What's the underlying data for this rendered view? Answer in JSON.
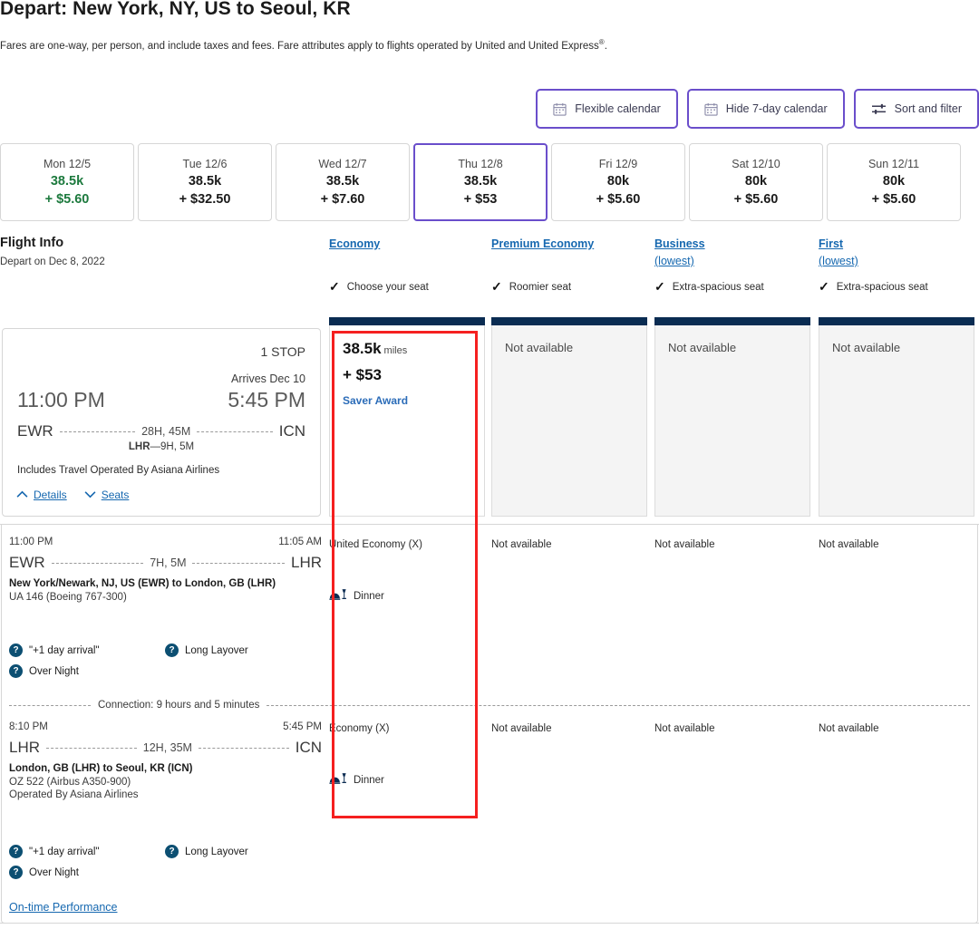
{
  "header": {
    "title": "Depart: New York, NY, US to Seoul, KR",
    "note_line1": "Fares are one-way, per person, and include taxes and fees. Fare attributes apply to flights operated by United and United",
    "note_line2": "Express",
    "note_sup": "®",
    "note_period": "."
  },
  "toolbar": {
    "flexible_calendar": "Flexible calendar",
    "hide_7day_calendar": "Hide 7-day calendar",
    "sort_and_filter": "Sort and filter",
    "accent_purple": "#6a4ecb"
  },
  "date_strip": {
    "cards": [
      {
        "dow": "Mon 12/5",
        "miles": "38.5k",
        "cash": "+ $5.60",
        "selected": false,
        "lowest": true
      },
      {
        "dow": "Tue 12/6",
        "miles": "38.5k",
        "cash": "+ $32.50",
        "selected": false,
        "lowest": false
      },
      {
        "dow": "Wed 12/7",
        "miles": "38.5k",
        "cash": "+ $7.60",
        "selected": false,
        "lowest": false
      },
      {
        "dow": "Thu 12/8",
        "miles": "38.5k",
        "cash": "+ $53",
        "selected": true,
        "lowest": false
      },
      {
        "dow": "Fri 12/9",
        "miles": "80k",
        "cash": "+ $5.60",
        "selected": false,
        "lowest": false
      },
      {
        "dow": "Sat 12/10",
        "miles": "80k",
        "cash": "+ $5.60",
        "selected": false,
        "lowest": false
      },
      {
        "dow": "Sun 12/11",
        "miles": "80k",
        "cash": "+ $5.60",
        "selected": false,
        "lowest": false
      }
    ],
    "lowest_color": "#1d7a3e"
  },
  "flight_info": {
    "label": "Flight Info",
    "depart_on": "Depart on Dec 8, 2022"
  },
  "cabins": [
    {
      "name": "Economy",
      "lowest": "",
      "perk": "Choose your seat"
    },
    {
      "name": "Premium Economy",
      "lowest": "",
      "perk": "Roomier seat"
    },
    {
      "name": "Business",
      "lowest": "(lowest)",
      "perk": "Extra-spacious seat"
    },
    {
      "name": "First",
      "lowest": "(lowest)",
      "perk": "Extra-spacious seat"
    }
  ],
  "summary": {
    "stops": "1 STOP",
    "arrives": "Arrives Dec 10",
    "depart_time": "11:00 PM",
    "arrive_time": "5:45 PM",
    "origin": "EWR",
    "destination": "ICN",
    "duration": "28H, 45M",
    "layover_code": "LHR",
    "layover_sep": "—",
    "layover_dur": "9H, 5M",
    "operated_note": "Includes Travel Operated By Asiana Airlines",
    "details_link": "Details",
    "seats_link": "Seats"
  },
  "summary_fares": [
    {
      "available": true,
      "miles": "38.5k",
      "miles_unit": "miles",
      "cash": "+ $53",
      "award": "Saver Award",
      "na_text": ""
    },
    {
      "available": false,
      "miles": "",
      "miles_unit": "",
      "cash": "",
      "award": "",
      "na_text": "Not available"
    },
    {
      "available": false,
      "miles": "",
      "miles_unit": "",
      "cash": "",
      "award": "",
      "na_text": "Not available"
    },
    {
      "available": false,
      "miles": "",
      "miles_unit": "",
      "cash": "",
      "award": "",
      "na_text": "Not available"
    }
  ],
  "segments": [
    {
      "depart_time": "11:00 PM",
      "arrive_time": "11:05 AM",
      "origin": "EWR",
      "destination": "LHR",
      "duration": "7H, 5M",
      "city_pair": "New York/Newark, NJ, US (EWR) to London, GB (LHR)",
      "flight": "UA 146 (Boeing 767-300)",
      "operated_by": "",
      "badges": [
        "\"+1 day arrival\"",
        "Long Layover",
        "Over Night"
      ],
      "fares": [
        {
          "cabin": "United Economy (X)",
          "meal": "Dinner"
        },
        {
          "cabin": "Not available",
          "meal": ""
        },
        {
          "cabin": "Not available",
          "meal": ""
        },
        {
          "cabin": "Not available",
          "meal": ""
        }
      ]
    },
    {
      "depart_time": "8:10 PM",
      "arrive_time": "5:45 PM",
      "origin": "LHR",
      "destination": "ICN",
      "duration": "12H, 35M",
      "city_pair": "London, GB (LHR) to Seoul, KR (ICN)",
      "flight": "OZ 522 (Airbus A350-900)",
      "operated_by": "Operated By Asiana Airlines",
      "badges": [
        "\"+1 day arrival\"",
        "Long Layover",
        "Over Night"
      ],
      "fares": [
        {
          "cabin": "Economy (X)",
          "meal": "Dinner"
        },
        {
          "cabin": "Not available",
          "meal": ""
        },
        {
          "cabin": "Not available",
          "meal": ""
        },
        {
          "cabin": "Not available",
          "meal": ""
        }
      ]
    }
  ],
  "connection": {
    "text": "Connection: 9 hours and 5 minutes"
  },
  "footer": {
    "on_time_performance": "On-time Performance"
  },
  "colors": {
    "navy": "#0a2c52",
    "link_blue": "#1668b0",
    "highlight_red": "#f52020",
    "badge_blue": "#0c4f72"
  }
}
